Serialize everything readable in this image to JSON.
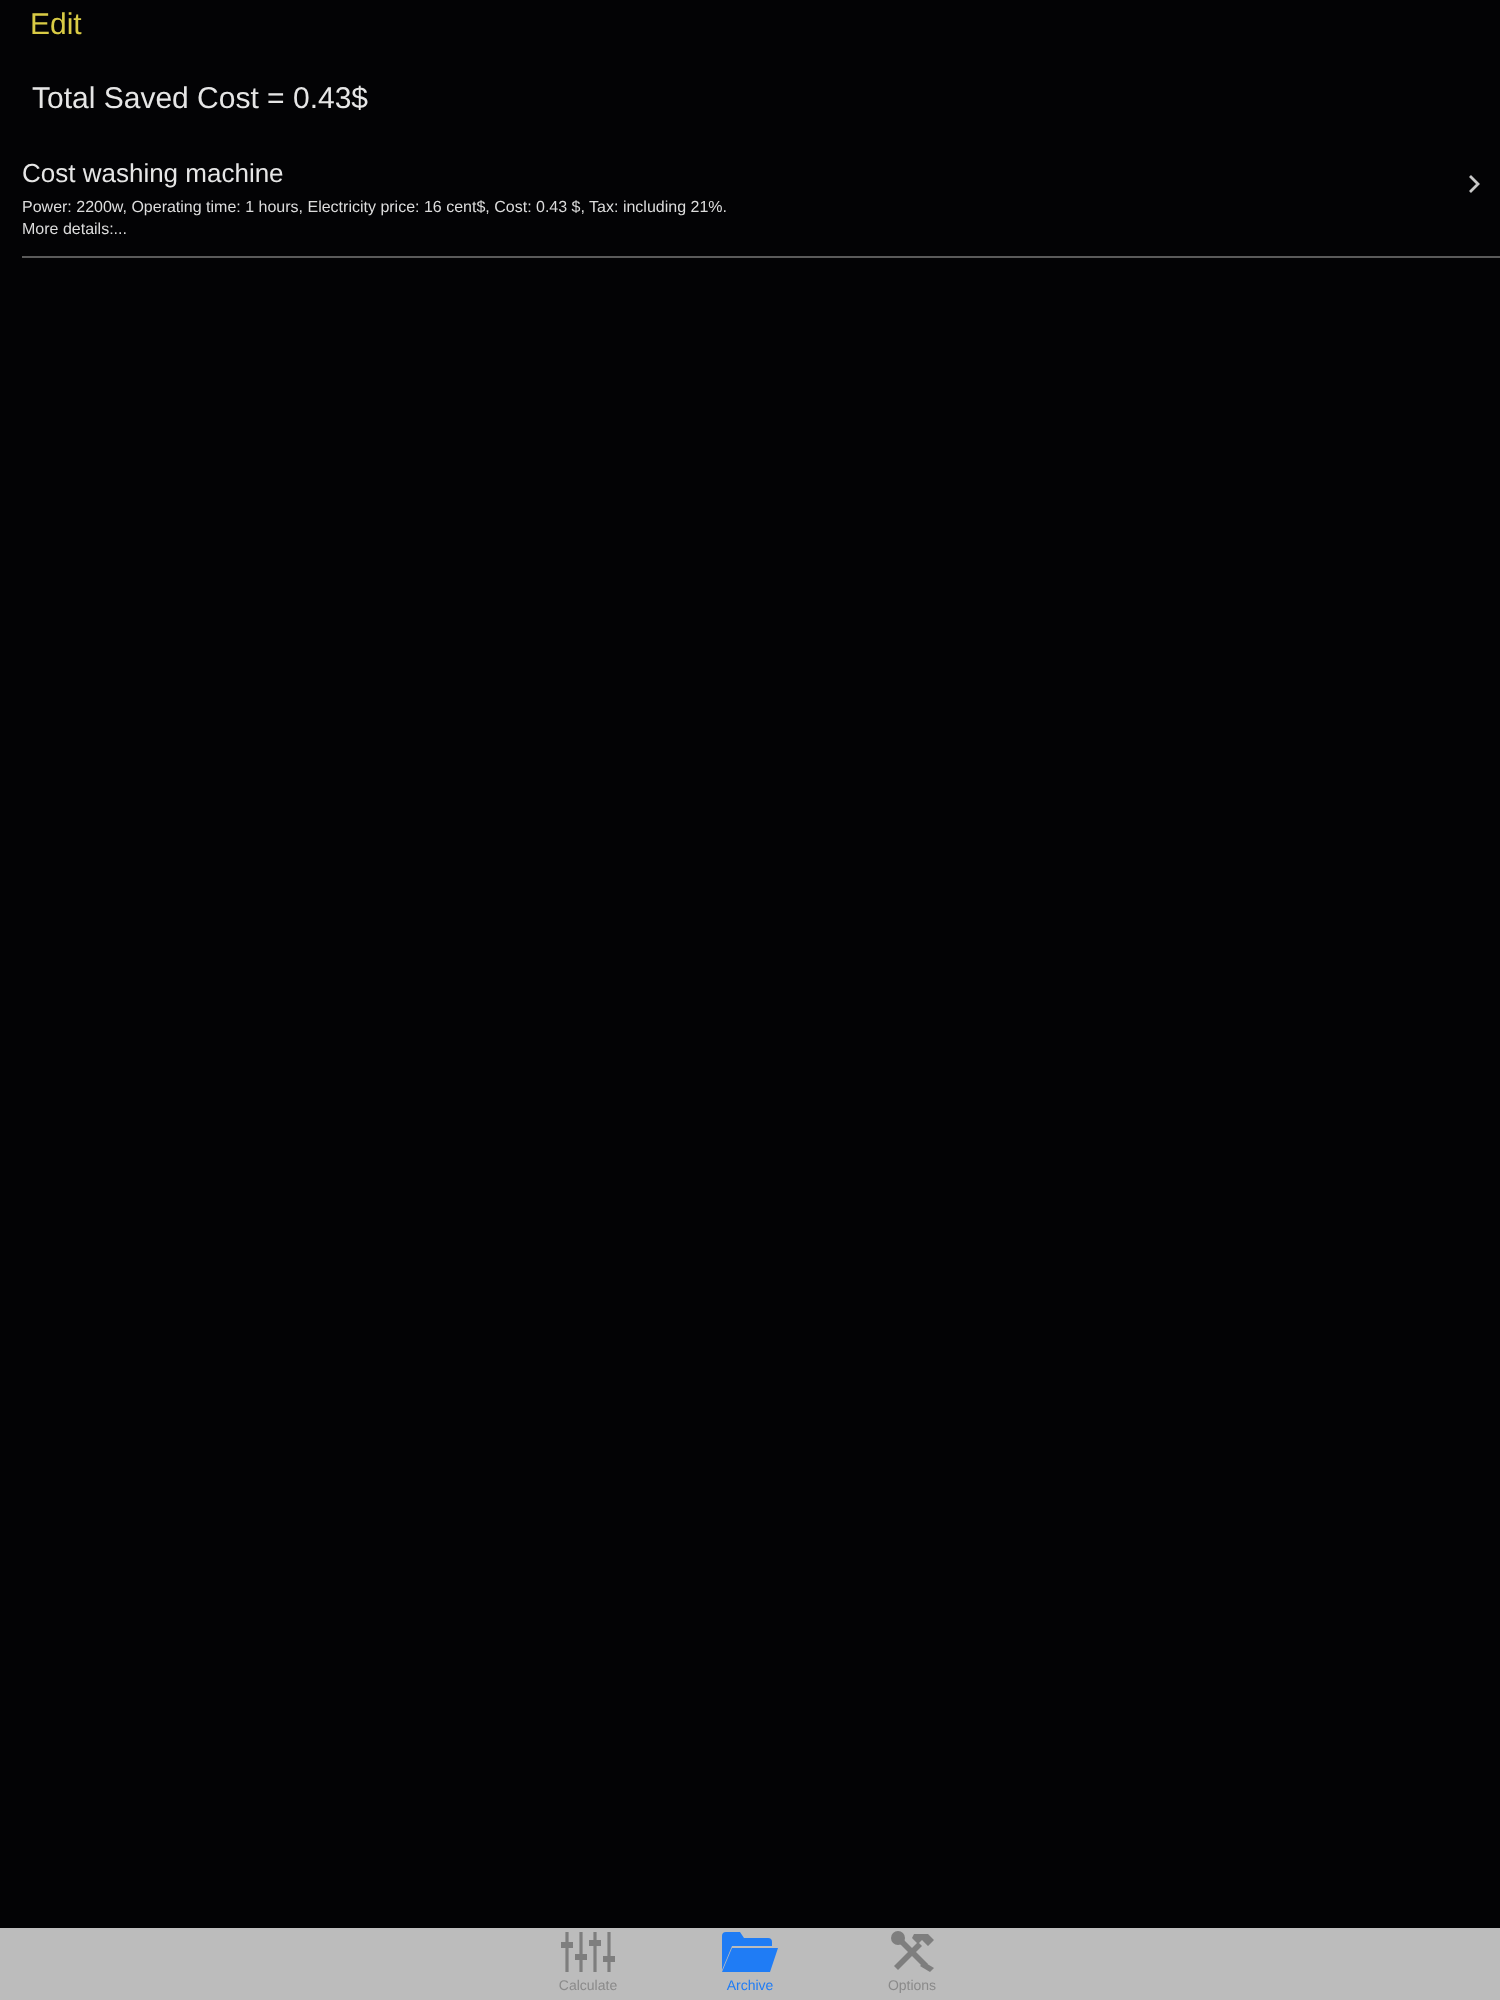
{
  "nav": {
    "edit_button": "Edit"
  },
  "summary": "Total Saved Cost = 0.43$",
  "rows": [
    {
      "title": "Cost washing machine",
      "details": "Power: 2200w, Operating time: 1 hours, Electricity price: 16 cent$, Cost: 0.43 $, Tax: including 21%.",
      "more": "More details:..."
    }
  ],
  "tab_bar": [
    {
      "label": "Calculate",
      "kind": "sliders",
      "selected": false
    },
    {
      "label": "Archive",
      "kind": "folder",
      "selected": true
    },
    {
      "label": "Options",
      "kind": "tools",
      "selected": false
    }
  ]
}
